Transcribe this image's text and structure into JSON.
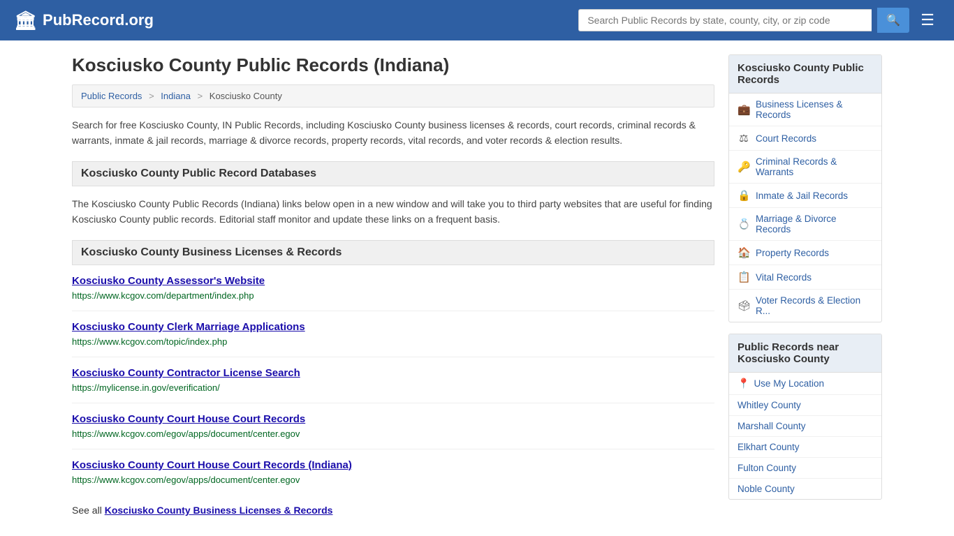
{
  "header": {
    "logo_icon": "🏛",
    "logo_text": "PubRecord.org",
    "search_placeholder": "Search Public Records by state, county, city, or zip code",
    "search_value": ""
  },
  "page": {
    "title": "Kosciusko County Public Records (Indiana)",
    "breadcrumb": {
      "items": [
        "Public Records",
        "Indiana",
        "Kosciusko County"
      ]
    },
    "description": "Search for free Kosciusko County, IN Public Records, including Kosciusko County business licenses & records, court records, criminal records & warrants, inmate & jail records, marriage & divorce records, property records, vital records, and voter records & election results.",
    "databases_header": "Kosciusko County Public Record Databases",
    "databases_description": "The Kosciusko County Public Records (Indiana) links below open in a new window and will take you to third party websites that are useful for finding Kosciusko County public records. Editorial staff monitor and update these links on a frequent basis.",
    "business_section_header": "Kosciusko County Business Licenses & Records",
    "links": [
      {
        "title": "Kosciusko County Assessor's Website",
        "url": "https://www.kcgov.com/department/index.php"
      },
      {
        "title": "Kosciusko County Clerk Marriage Applications",
        "url": "https://www.kcgov.com/topic/index.php"
      },
      {
        "title": "Kosciusko County Contractor License Search",
        "url": "https://mylicense.in.gov/everification/"
      },
      {
        "title": "Kosciusko County Court House Court Records",
        "url": "https://www.kcgov.com/egov/apps/document/center.egov"
      },
      {
        "title": "Kosciusko County Court House Court Records (Indiana)",
        "url": "https://www.kcgov.com/egov/apps/document/center.egov"
      }
    ],
    "see_all_text": "See all",
    "see_all_link_text": "Kosciusko County Business Licenses & Records"
  },
  "sidebar": {
    "public_records_header": "Kosciusko County Public Records",
    "items": [
      {
        "icon": "💼",
        "label": "Business Licenses & Records"
      },
      {
        "icon": "⚖",
        "label": "Court Records"
      },
      {
        "icon": "🔑",
        "label": "Criminal Records & Warrants"
      },
      {
        "icon": "🔒",
        "label": "Inmate & Jail Records"
      },
      {
        "icon": "💍",
        "label": "Marriage & Divorce Records"
      },
      {
        "icon": "🏠",
        "label": "Property Records"
      },
      {
        "icon": "📋",
        "label": "Vital Records"
      },
      {
        "icon": "🗳",
        "label": "Voter Records & Election R..."
      }
    ],
    "nearby_header": "Public Records near Kosciusko County",
    "use_location_label": "Use My Location",
    "nearby_counties": [
      "Whitley County",
      "Marshall County",
      "Elkhart County",
      "Fulton County",
      "Noble County"
    ]
  }
}
